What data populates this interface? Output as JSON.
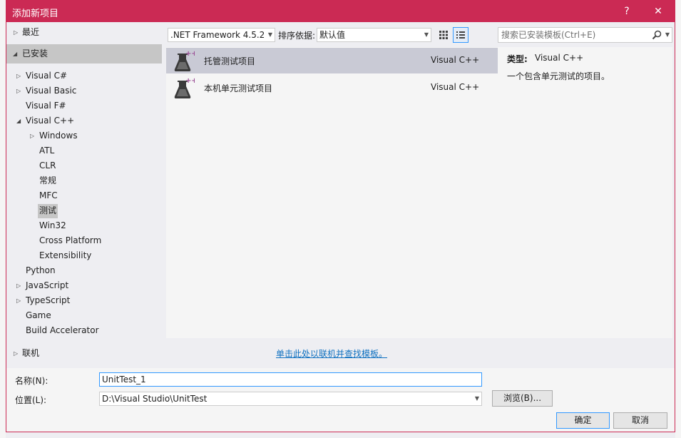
{
  "dialog": {
    "title": "添加新项目",
    "help_label": "?",
    "close_label": "✕"
  },
  "tree": {
    "recent": "最近",
    "installed": "已安装",
    "items": [
      {
        "label": "Visual C#",
        "expander": true
      },
      {
        "label": "Visual Basic",
        "expander": true
      },
      {
        "label": "Visual F#",
        "expander": false
      },
      {
        "label": "Visual C++",
        "expander": true,
        "expanded": true
      },
      {
        "label": "Windows",
        "expander": true
      },
      {
        "label": "ATL",
        "expander": false
      },
      {
        "label": "CLR",
        "expander": false
      },
      {
        "label": "常规",
        "expander": false
      },
      {
        "label": "MFC",
        "expander": false
      },
      {
        "label": "测试",
        "expander": false,
        "selected": true
      },
      {
        "label": "Win32",
        "expander": false
      },
      {
        "label": "Cross Platform",
        "expander": false
      },
      {
        "label": "Extensibility",
        "expander": false
      },
      {
        "label": "Python",
        "expander": false
      },
      {
        "label": "JavaScript",
        "expander": true
      },
      {
        "label": "TypeScript",
        "expander": true
      },
      {
        "label": "Game",
        "expander": false
      },
      {
        "label": "Build Accelerator",
        "expander": false
      }
    ],
    "online": "联机"
  },
  "toolbar": {
    "framework": ".NET Framework 4.5.2",
    "sort_label": "排序依据:",
    "sort_value": "默认值",
    "search_placeholder": "搜索已安装模板(Ctrl+E)"
  },
  "templates": [
    {
      "name": "托管测试项目",
      "language": "Visual C++",
      "selected": true
    },
    {
      "name": "本机单元测试项目",
      "language": "Visual C++",
      "selected": false
    }
  ],
  "info": {
    "type_label": "类型:",
    "type_value": "Visual C++",
    "description": "一个包含单元测试的项目。"
  },
  "online_link": "单击此处以联机并查找模板。",
  "form": {
    "name_label": "名称(N):",
    "name_value": "UnitTest_1",
    "location_label": "位置(L):",
    "location_value": "D:\\Visual Studio\\UnitTest",
    "browse_label": "浏览(B)...",
    "ok_label": "确定",
    "cancel_label": "取消"
  },
  "colors": {
    "accent": "#cb2a54",
    "selection": "#c9cad5",
    "link": "#0e70c0"
  }
}
